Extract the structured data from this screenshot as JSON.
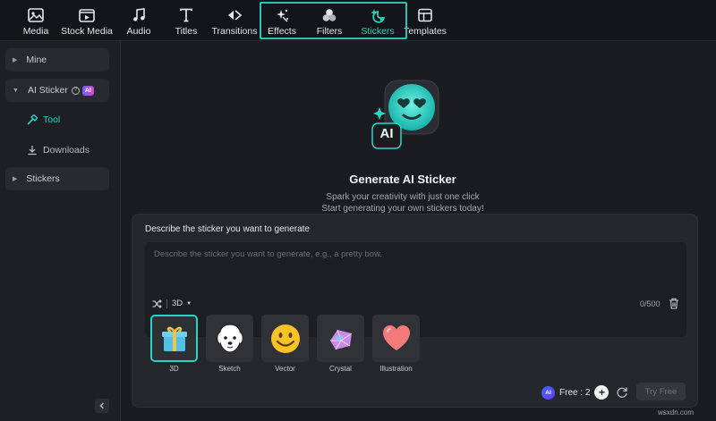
{
  "toolbar": {
    "tabs": [
      {
        "label": "Media",
        "icon": "media-icon"
      },
      {
        "label": "Stock Media",
        "icon": "stock-media-icon"
      },
      {
        "label": "Audio",
        "icon": "audio-icon"
      },
      {
        "label": "Titles",
        "icon": "titles-icon"
      },
      {
        "label": "Transitions",
        "icon": "transitions-icon"
      },
      {
        "label": "Effects",
        "icon": "effects-icon"
      },
      {
        "label": "Filters",
        "icon": "filters-icon"
      },
      {
        "label": "Stickers",
        "icon": "stickers-icon",
        "active": true
      },
      {
        "label": "Templates",
        "icon": "templates-icon"
      }
    ],
    "highlight_color": "#24c6b9"
  },
  "sidebar": {
    "mine": "Mine",
    "ai_sticker": "AI Sticker",
    "ai_badge": "AI",
    "tool": "Tool",
    "downloads": "Downloads",
    "stickers": "Stickers"
  },
  "hero": {
    "badge_text": "AI",
    "title": "Generate AI Sticker",
    "subtitle_line1": "Spark your creativity with just one click",
    "subtitle_line2": "Start generating your own stickers today!"
  },
  "panel": {
    "label": "Describe the sticker you want to generate",
    "placeholder": "Describe the sticker you want to generate, e.g., a pretty bow.",
    "style_value": "3D",
    "counter": "0/500",
    "styles": [
      {
        "label": "3D",
        "icon": "gift-box-icon",
        "selected": true
      },
      {
        "label": "Sketch",
        "icon": "dog-sketch-icon"
      },
      {
        "label": "Vector",
        "icon": "smiley-icon"
      },
      {
        "label": "Crystal",
        "icon": "crystal-icon"
      },
      {
        "label": "Illustration",
        "icon": "heart-icon"
      }
    ],
    "ai_coin": "AI",
    "free_label": "Free : 2",
    "try_free": "Try Free"
  },
  "colors": {
    "accent": "#27d3c3",
    "background": "#1b1c20"
  },
  "watermark": "wsxdn.com"
}
